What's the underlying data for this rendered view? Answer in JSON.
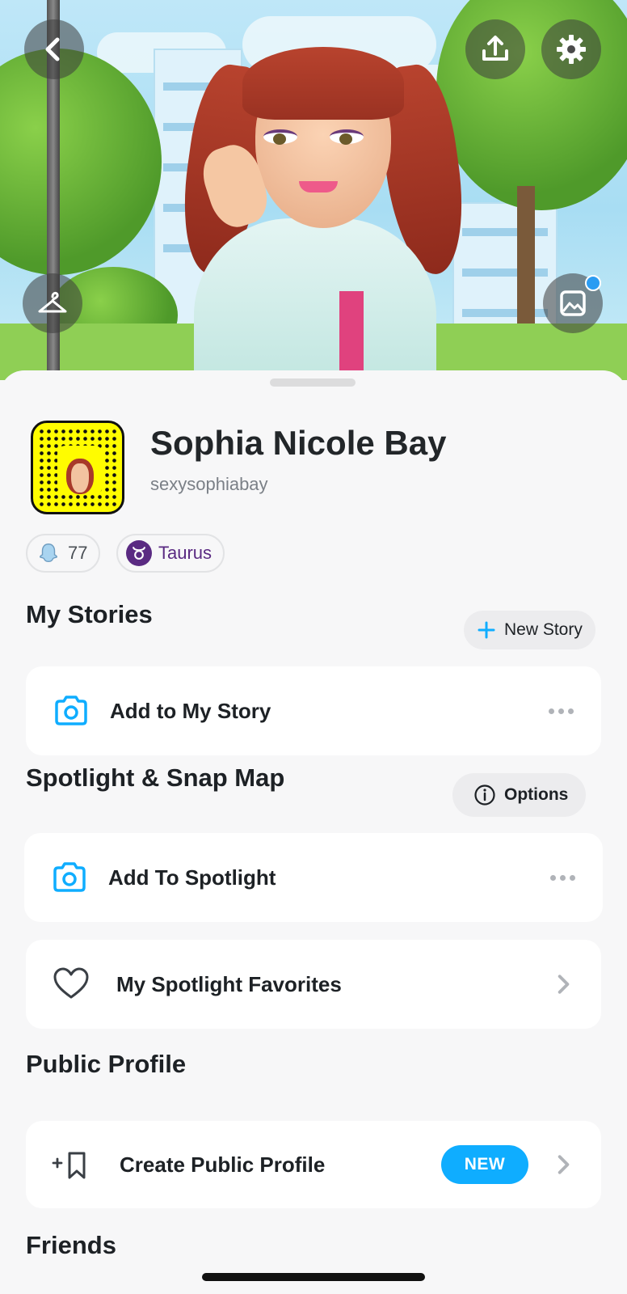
{
  "profile": {
    "display_name": "Sophia Nicole Bay",
    "username": "sexysophiabay",
    "snap_score": "77",
    "zodiac": "Taurus"
  },
  "header_buttons": {
    "back": "chevron-left-icon",
    "share": "share-upload-icon",
    "settings": "gear-icon",
    "wardrobe": "hanger-icon",
    "backgrounds": "image-icon"
  },
  "my_stories": {
    "title": "My Stories",
    "new_story_label": "New Story",
    "add_item_label": "Add to My Story"
  },
  "spotlight": {
    "title": "Spotlight & Snap Map",
    "options_label": "Options",
    "add_item_label": "Add To Spotlight",
    "favorites_label": "My Spotlight Favorites"
  },
  "public_profile": {
    "title": "Public Profile",
    "create_label": "Create Public Profile",
    "badge": "NEW"
  },
  "friends": {
    "title": "Friends"
  },
  "colors": {
    "accent_blue": "#0fadff",
    "snapcode_yellow": "#fffc00",
    "zodiac_purple": "#5a2a82"
  }
}
